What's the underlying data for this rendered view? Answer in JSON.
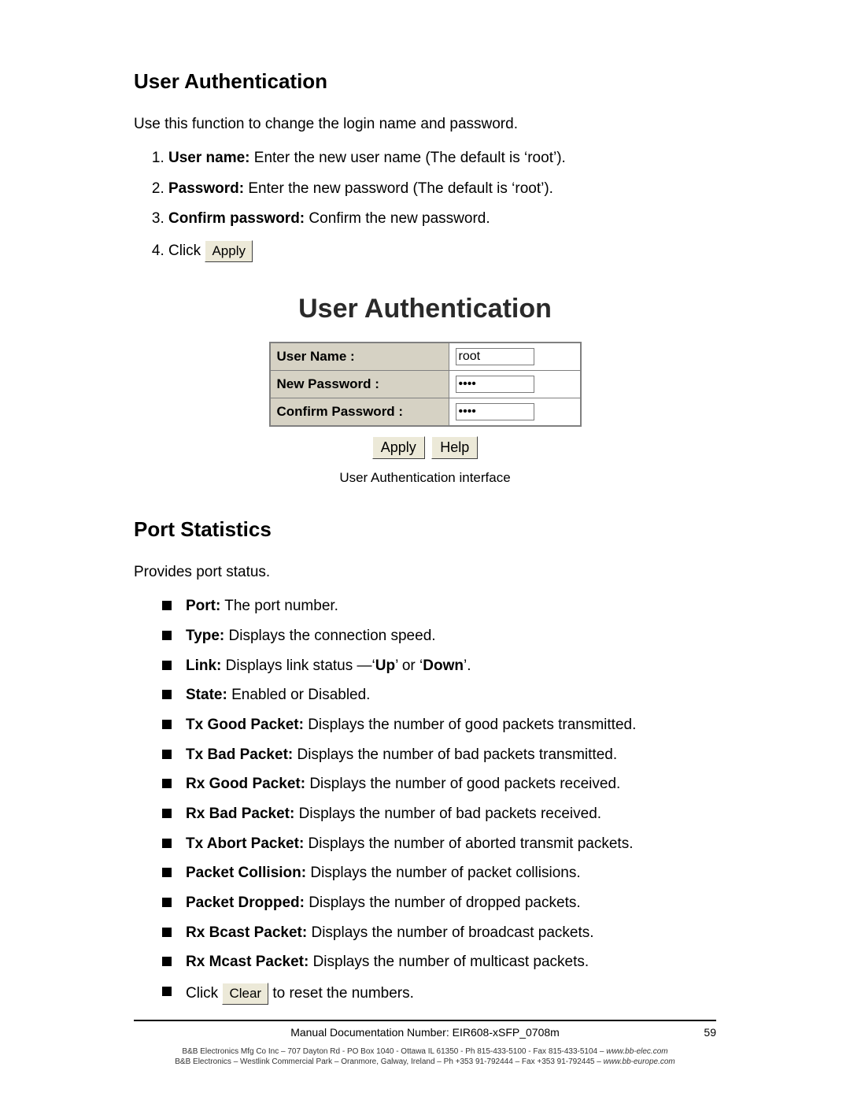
{
  "section1": {
    "heading": "User Authentication",
    "intro": "Use this function to change the login name and password.",
    "items": [
      {
        "label": "User name:",
        "text": " Enter the new user name (The default is ‘root’)."
      },
      {
        "label": "Password:",
        "text": " Enter the new password (The default is ‘root’)."
      },
      {
        "label": "Confirm password:",
        "text": " Confirm the new password."
      }
    ],
    "clickPrefix": "Click ",
    "applyBtn": "Apply"
  },
  "figure": {
    "title": "User Authentication",
    "rows": {
      "r1_label": "User Name :",
      "r1_value": "root",
      "r2_label": "New Password :",
      "r2_value": "••••",
      "r3_label": "Confirm Password :",
      "r3_value": "••••"
    },
    "btnApply": "Apply",
    "btnHelp": "Help",
    "caption": "User Authentication interface"
  },
  "section2": {
    "heading": "Port Statistics",
    "intro": "Provides port status.",
    "items": [
      {
        "label": "Port:",
        "text": " The port number."
      },
      {
        "label": "Type:",
        "text": " Displays the connection speed."
      },
      {
        "label": "Link:",
        "html": " Displays link status —‘<b>Up</b>’ or ‘<b>Down</b>’."
      },
      {
        "label": "State:",
        "text": " Enabled or Disabled."
      },
      {
        "label": "Tx Good Packet:",
        "text": " Displays the number of good packets transmitted."
      },
      {
        "label": "Tx Bad Packet:",
        "text": " Displays the number of bad packets transmitted."
      },
      {
        "label": "Rx Good Packet:",
        "text": " Displays the number of good packets received."
      },
      {
        "label": "Rx Bad Packet:",
        "text": " Displays the number of bad packets received."
      },
      {
        "label": "Tx Abort Packet:",
        "text": " Displays the number of aborted transmit packets."
      },
      {
        "label": "Packet Collision:",
        "text": " Displays the number of packet collisions."
      },
      {
        "label": "Packet Dropped:",
        "text": " Displays the number of dropped packets."
      },
      {
        "label": "Rx Bcast Packet:",
        "text": " Displays the number of broadcast packets."
      },
      {
        "label": "Rx Mcast Packet:",
        "text": " Displays the number of multicast packets."
      }
    ],
    "last": {
      "pre": "Click ",
      "btn": "Clear",
      "post": " to reset the numbers."
    }
  },
  "footer": {
    "docline": "Manual Documentation Number: EIR608-xSFP_0708m",
    "pagenum": "59",
    "line2a": "B&B Electronics Mfg Co Inc – 707 Dayton Rd - PO Box 1040 - Ottawa IL 61350 - Ph 815-433-5100 - Fax 815-433-5104 – ",
    "line2b": "www.bb-elec.com",
    "line3a": "B&B Electronics – Westlink Commercial Park – Oranmore, Galway, Ireland – Ph +353 91-792444 – Fax +353 91-792445 – ",
    "line3b": "www.bb-europe.com"
  }
}
